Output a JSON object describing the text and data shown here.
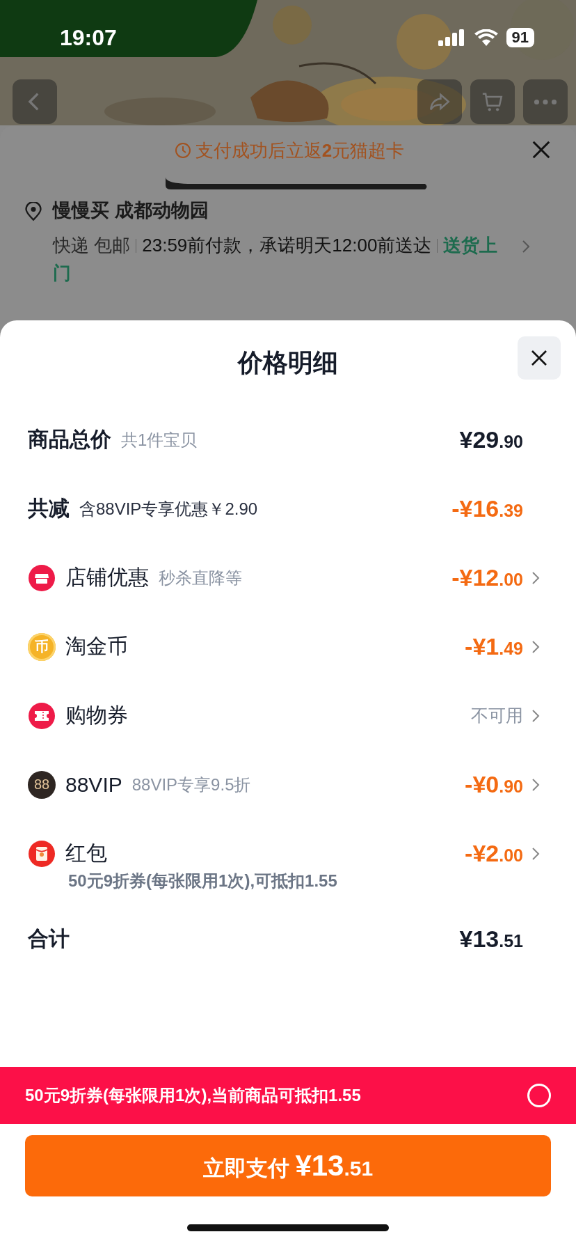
{
  "status_bar": {
    "time": "19:07",
    "battery": "91"
  },
  "order_card": {
    "notice": "支付成功后立返**2**元猫超卡",
    "address": "慢慢买 成都动物园",
    "delivery": [
      {
        "text": "快递 包邮"
      },
      {
        "text": "23:59前付款，承诺明天12:00前送达"
      },
      {
        "text": "送货上门"
      }
    ]
  },
  "sheet": {
    "title": "价格明细",
    "rows": [
      {
        "kind": "summary",
        "label": "商品总价",
        "note": "共1件宝贝",
        "price_main": "¥29",
        "price_fraction": ".90"
      },
      {
        "kind": "summary",
        "label": "共减",
        "note": "含88VIP专享优惠￥2.90",
        "price_main": "-¥16",
        "price_fraction": ".39"
      },
      {
        "kind": "discount",
        "label": "店铺优惠",
        "note": "秒杀直降等",
        "price_main": "-¥12",
        "price_fraction": ".00"
      },
      {
        "kind": "discount",
        "badge": "币",
        "label": "淘金币",
        "price_main": "-¥1",
        "price_fraction": ".49"
      },
      {
        "kind": "discount",
        "label": "购物券",
        "status": "不可用"
      },
      {
        "kind": "discount",
        "badge": "88",
        "label": "88VIP",
        "note": "88VIP专享9.5折",
        "price_main": "-¥0",
        "price_fraction": ".90"
      },
      {
        "kind": "discount",
        "label": "红包",
        "detail": "50元9折券(每张限用1次),可抵扣1.55",
        "price_main": "-¥2",
        "price_fraction": ".00"
      },
      {
        "kind": "total",
        "label": "合计",
        "price_main": "¥13",
        "price_fraction": ".51"
      }
    ]
  },
  "promo_bar": {
    "text": "50元9折券(每张限用1次),当前商品可抵扣1.55",
    "selected": false
  },
  "pay_button": {
    "label": "立即支付",
    "price_main": "¥13",
    "price_fraction": ".51"
  }
}
